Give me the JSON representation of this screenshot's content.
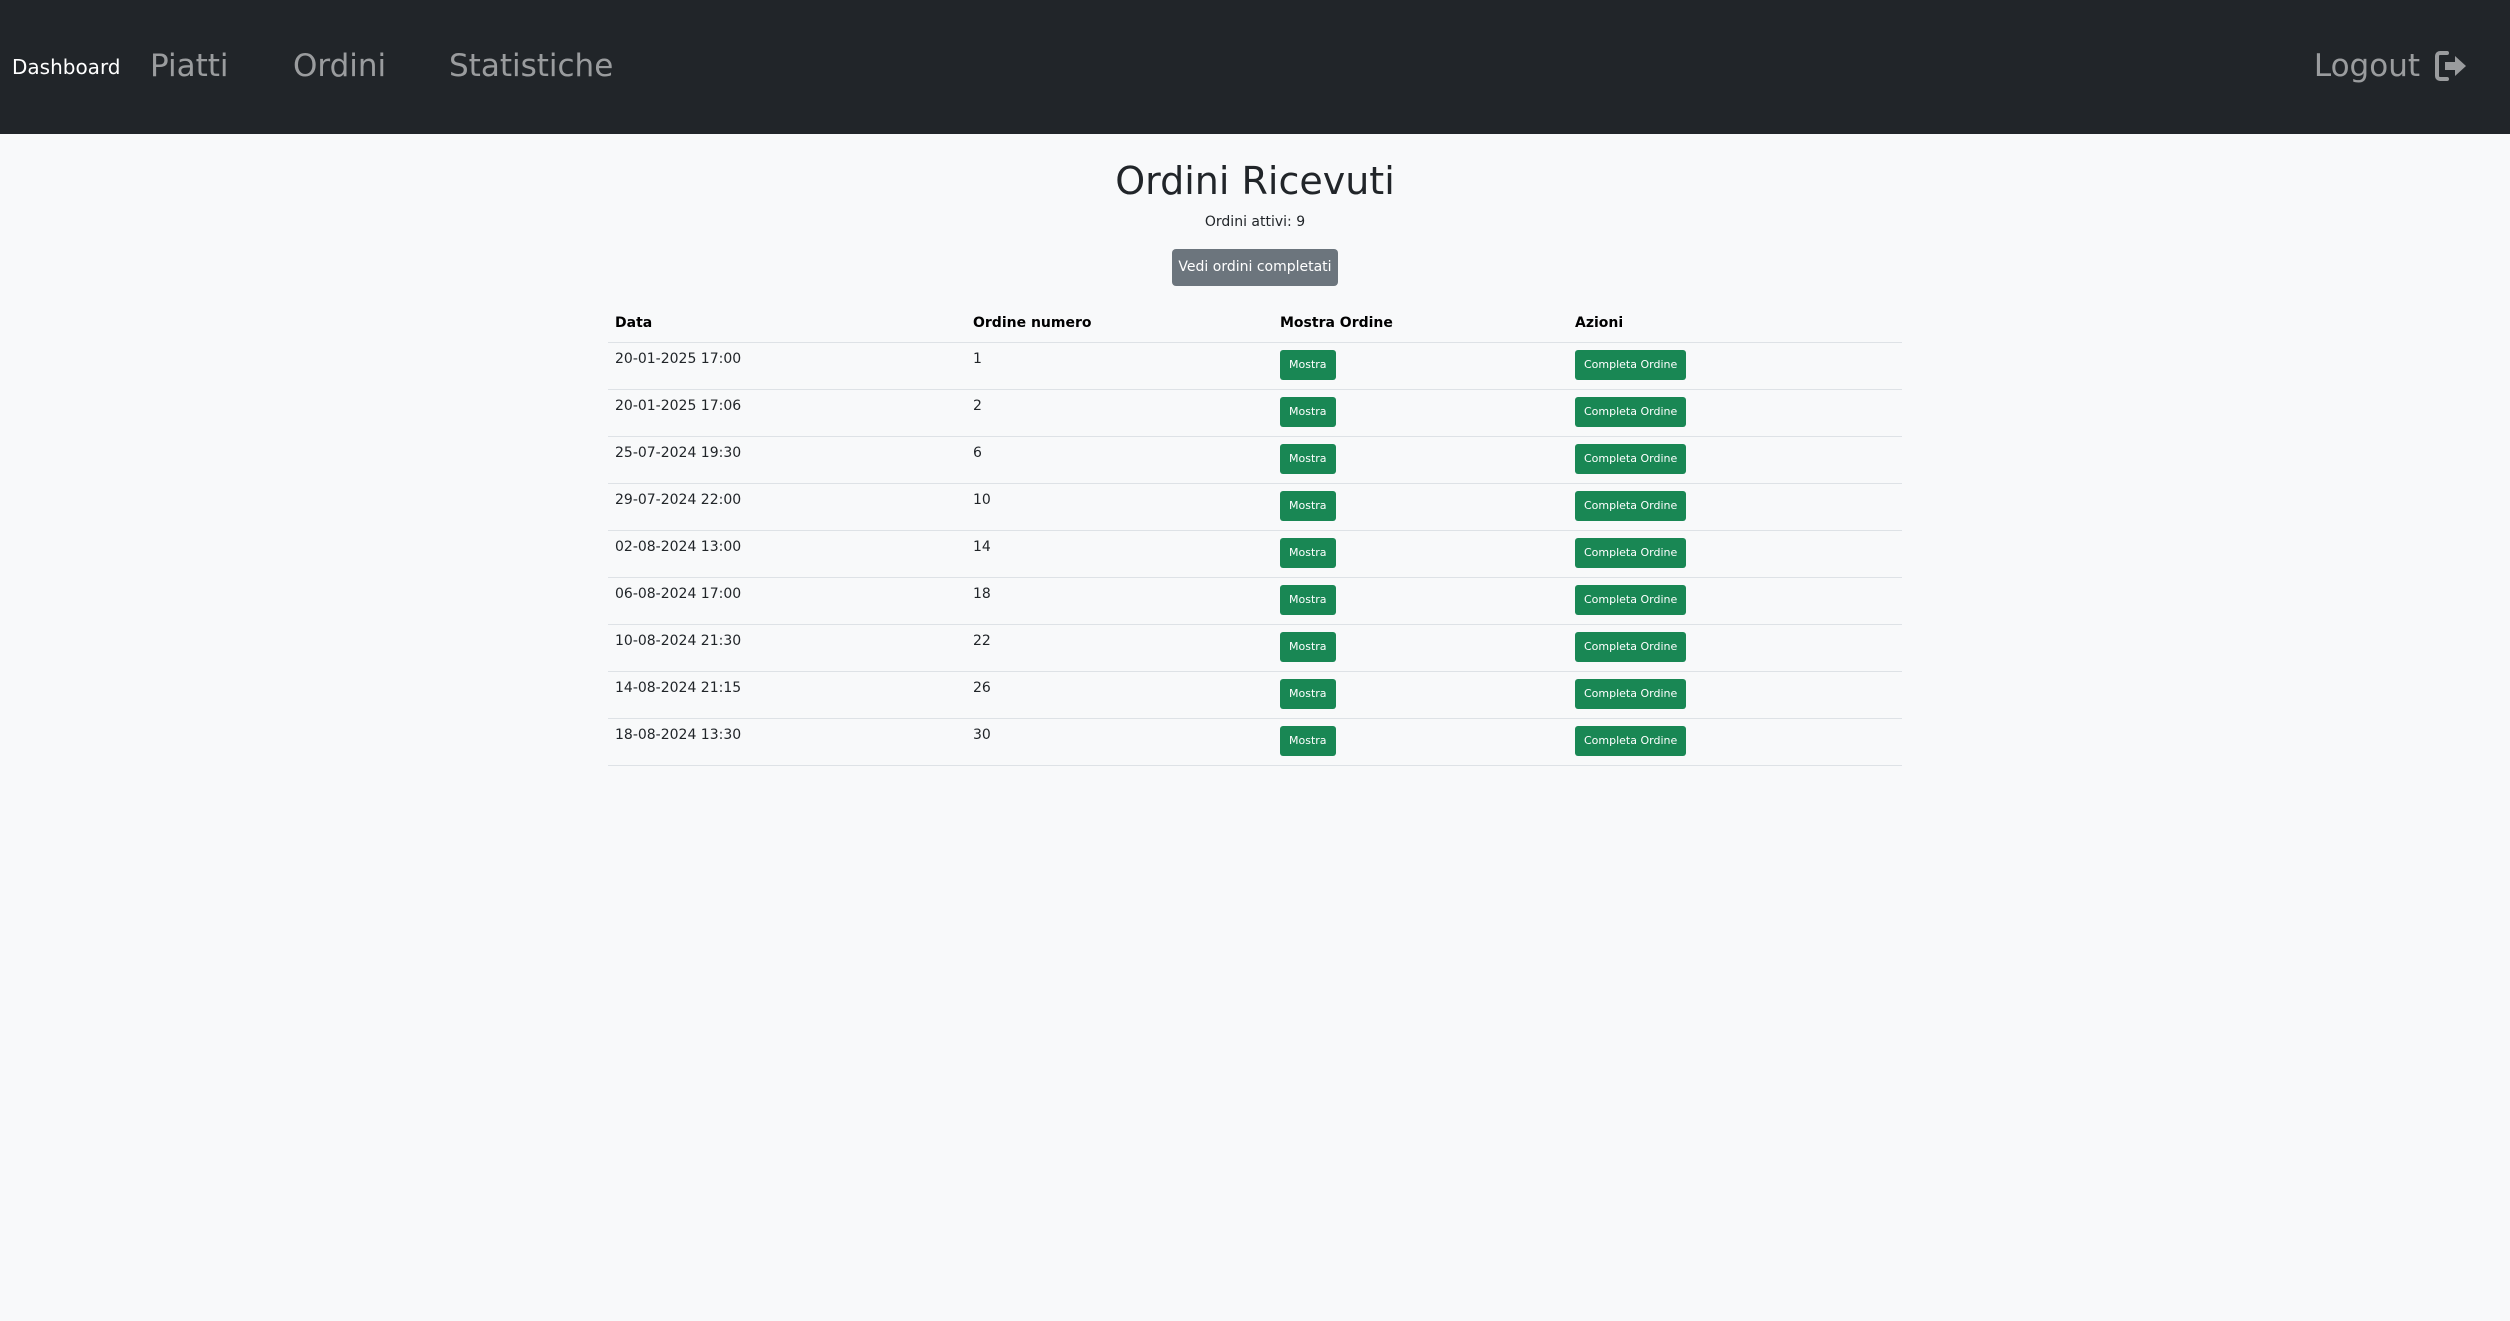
{
  "navbar": {
    "brand": "Dashboard",
    "links": [
      "Piatti",
      "Ordini",
      "Statistiche"
    ],
    "logout_label": "Logout",
    "logout_icon": "logout-icon"
  },
  "main": {
    "title": "Ordini Ricevuti",
    "active_orders": "Ordini attivi: 9",
    "completed_button": "Vedi ordini completati"
  },
  "table": {
    "headers": [
      "Data",
      "Ordine numero",
      "Mostra Ordine",
      "Azioni"
    ],
    "show_label": "Mostra",
    "complete_label": "Completa Ordine",
    "rows": [
      {
        "date": "20-01-2025 17:00",
        "number": "1"
      },
      {
        "date": "20-01-2025 17:06",
        "number": "2"
      },
      {
        "date": "25-07-2024 19:30",
        "number": "6"
      },
      {
        "date": "29-07-2024 22:00",
        "number": "10"
      },
      {
        "date": "02-08-2024 13:00",
        "number": "14"
      },
      {
        "date": "06-08-2024 17:00",
        "number": "18"
      },
      {
        "date": "10-08-2024 21:30",
        "number": "22"
      },
      {
        "date": "14-08-2024 21:15",
        "number": "26"
      },
      {
        "date": "18-08-2024 13:30",
        "number": "30"
      }
    ]
  },
  "colors": {
    "navbar_bg": "#212529",
    "page_bg": "#f8f9fa",
    "success": "#198754",
    "secondary": "#6c757d"
  }
}
